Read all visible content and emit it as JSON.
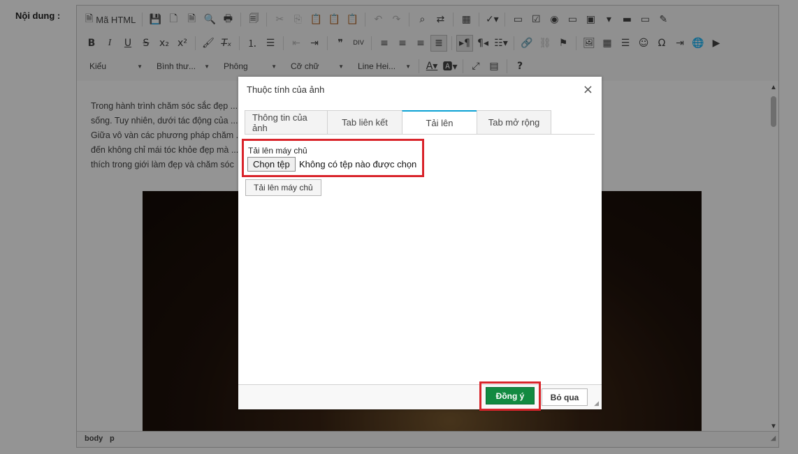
{
  "form": {
    "label": "Nội dung :"
  },
  "toolbar": {
    "source_label": "Mã HTML",
    "styles_combo": "Kiểu",
    "format_combo": "Bình thư...",
    "font_combo": "Phông",
    "size_combo": "Cỡ chữ",
    "lineheight_combo": "Line Hei..."
  },
  "content": {
    "paragraph_lines": [
      "Trong hành trình chăm sóc sắc đẹp ... n là biểu tượng của sự tự tin và sức",
      "sống. Tuy nhiên, dưới tác động của ... đầu gặp phải nhiều vấn đề khó chịu.",
      "Giữa vô vàn các phương pháp chăm ... giữa truyền thống và hiện đại, mang",
      "đến không chỉ mái tóc khỏe đẹp mà ... hó trở thành một xu hướng được yêu",
      "thích trong giới làm đẹp và chăm sóc"
    ]
  },
  "statusbar": {
    "path": [
      "body",
      "p"
    ]
  },
  "dialog": {
    "title": "Thuộc tính của ảnh",
    "close_symbol": "×",
    "tabs": [
      {
        "label": "Thông tin của ảnh",
        "active": false
      },
      {
        "label": "Tab liên kết",
        "active": false
      },
      {
        "label": "Tải lên",
        "active": true
      },
      {
        "label": "Tab mở rộng",
        "active": false
      }
    ],
    "upload": {
      "label": "Tải lên máy chủ",
      "choose_button": "Chọn tệp",
      "file_status": "Không có tệp nào được chọn",
      "send_button": "Tải lên máy chủ"
    },
    "footer": {
      "ok_button": "Đồng ý",
      "cancel_button": "Bỏ qua"
    }
  },
  "colors": {
    "ok_green": "#128a41",
    "highlight_red": "#d9242b",
    "tab_accent": "#0aa1d4"
  }
}
